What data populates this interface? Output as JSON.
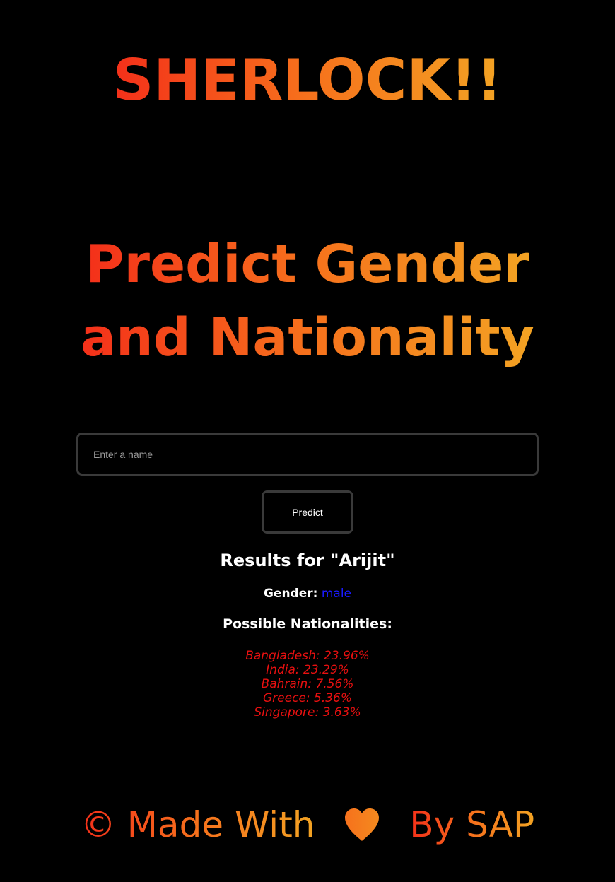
{
  "app": {
    "logo_text": "SHERLOCK!!",
    "headline_line1": "Predict Gender",
    "headline_line2": "and Nationality"
  },
  "form": {
    "name_placeholder": "Enter a name",
    "name_value": "",
    "predict_label": "Predict"
  },
  "results": {
    "title": "Results for \"Arijit\"",
    "gender_label": "Gender:",
    "gender_value": "male",
    "nationalities_title": "Possible Nationalities:",
    "nationalities": [
      "Bangladesh: 23.96%",
      "India: 23.29%",
      "Bahrain: 7.56%",
      "Greece: 5.36%",
      "Singapore: 3.63%"
    ]
  },
  "footer": {
    "left_text": "© Made With",
    "icon": "heart-icon",
    "right_text": "By SAP"
  },
  "colors": {
    "background": "#000000",
    "gradient_start": "#f4301a",
    "gradient_end": "#f3a323",
    "gender_value": "#1a1aff",
    "nationality_text": "#e81010",
    "border": "#3a3a3a"
  }
}
